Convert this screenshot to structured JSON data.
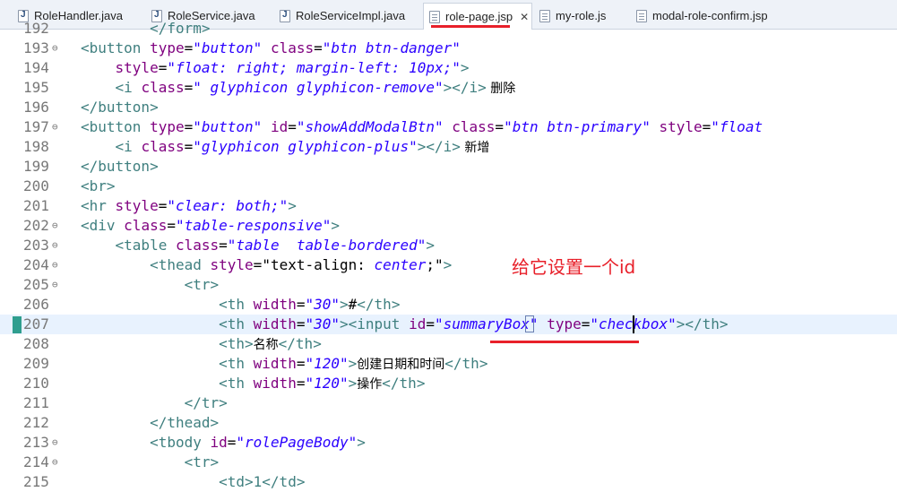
{
  "tabs": [
    {
      "label": "RoleHandler.java",
      "type": "java"
    },
    {
      "label": "RoleService.java",
      "type": "java"
    },
    {
      "label": "RoleServiceImpl.java",
      "type": "java"
    },
    {
      "label": "role-page.jsp",
      "type": "doc",
      "active": true
    },
    {
      "label": "my-role.js",
      "type": "doc"
    },
    {
      "label": "modal-role-confirm.jsp",
      "type": "doc"
    }
  ],
  "close_glyph": "✕",
  "annotation": "给它设置一个id",
  "colors": {
    "tag": "#3f7f7f",
    "attr": "#7f007f",
    "value": "#2a00ff",
    "annotation": "#e8202a"
  },
  "lines": [
    {
      "n": "192",
      "fold": false,
      "parts": [
        [
          "t",
          "        </form>"
        ]
      ]
    },
    {
      "n": "193",
      "fold": true,
      "parts": [
        [
          "t",
          "<button "
        ],
        [
          "a",
          "type"
        ],
        [
          "p",
          "="
        ],
        [
          "v",
          "\"button\""
        ],
        [
          "p",
          " "
        ],
        [
          "a",
          "class"
        ],
        [
          "p",
          "="
        ],
        [
          "v",
          "\"btn btn-danger\""
        ]
      ]
    },
    {
      "n": "194",
      "fold": false,
      "parts": [
        [
          "p",
          "    "
        ],
        [
          "a",
          "style"
        ],
        [
          "p",
          "="
        ],
        [
          "v",
          "\"float: right; margin-left: 10px;\""
        ],
        [
          "t",
          ">"
        ]
      ]
    },
    {
      "n": "195",
      "fold": false,
      "parts": [
        [
          "p",
          "    "
        ],
        [
          "t",
          "<i "
        ],
        [
          "a",
          "class"
        ],
        [
          "p",
          "="
        ],
        [
          "v",
          "\" glyphicon glyphicon-remove\""
        ],
        [
          "t",
          "></i>"
        ],
        [
          "cjk",
          " 删除"
        ]
      ]
    },
    {
      "n": "196",
      "fold": false,
      "parts": [
        [
          "t",
          "</button>"
        ]
      ]
    },
    {
      "n": "197",
      "fold": true,
      "parts": [
        [
          "t",
          "<button "
        ],
        [
          "a",
          "type"
        ],
        [
          "p",
          "="
        ],
        [
          "v",
          "\"button\""
        ],
        [
          "p",
          " "
        ],
        [
          "a",
          "id"
        ],
        [
          "p",
          "="
        ],
        [
          "v",
          "\"showAddModalBtn\""
        ],
        [
          "p",
          " "
        ],
        [
          "a",
          "class"
        ],
        [
          "p",
          "="
        ],
        [
          "v",
          "\"btn btn-primary\""
        ],
        [
          "p",
          " "
        ],
        [
          "a",
          "style"
        ],
        [
          "p",
          "="
        ],
        [
          "v",
          "\"float"
        ]
      ]
    },
    {
      "n": "198",
      "fold": false,
      "parts": [
        [
          "p",
          "    "
        ],
        [
          "t",
          "<i "
        ],
        [
          "a",
          "class"
        ],
        [
          "p",
          "="
        ],
        [
          "v",
          "\"glyphicon glyphicon-plus\""
        ],
        [
          "t",
          "></i>"
        ],
        [
          "cjk",
          " 新增"
        ]
      ]
    },
    {
      "n": "199",
      "fold": false,
      "parts": [
        [
          "t",
          "</button>"
        ]
      ]
    },
    {
      "n": "200",
      "fold": false,
      "parts": [
        [
          "t",
          "<br>"
        ]
      ]
    },
    {
      "n": "201",
      "fold": false,
      "parts": [
        [
          "t",
          "<hr "
        ],
        [
          "a",
          "style"
        ],
        [
          "p",
          "="
        ],
        [
          "v",
          "\"clear: both;\""
        ],
        [
          "t",
          ">"
        ]
      ]
    },
    {
      "n": "202",
      "fold": true,
      "parts": [
        [
          "t",
          "<div "
        ],
        [
          "a",
          "class"
        ],
        [
          "p",
          "="
        ],
        [
          "v",
          "\"table-responsive\""
        ],
        [
          "t",
          ">"
        ]
      ]
    },
    {
      "n": "203",
      "fold": true,
      "parts": [
        [
          "p",
          "    "
        ],
        [
          "t",
          "<table "
        ],
        [
          "a",
          "class"
        ],
        [
          "p",
          "="
        ],
        [
          "v",
          "\"table  table-bordered\""
        ],
        [
          "t",
          ">"
        ]
      ]
    },
    {
      "n": "204",
      "fold": true,
      "parts": [
        [
          "p",
          "        "
        ],
        [
          "t",
          "<thead "
        ],
        [
          "a",
          "style"
        ],
        [
          "p",
          "="
        ],
        [
          "p",
          "\"text-align: "
        ],
        [
          "v",
          "center"
        ],
        [
          "p",
          ";\""
        ],
        [
          "t",
          ">"
        ]
      ]
    },
    {
      "n": "205",
      "fold": true,
      "parts": [
        [
          "p",
          "            "
        ],
        [
          "t",
          "<tr>"
        ]
      ]
    },
    {
      "n": "206",
      "fold": false,
      "parts": [
        [
          "p",
          "                "
        ],
        [
          "t",
          "<th "
        ],
        [
          "a",
          "width"
        ],
        [
          "p",
          "="
        ],
        [
          "v",
          "\"30\""
        ],
        [
          "t",
          ">"
        ],
        [
          "p",
          "#"
        ],
        [
          "t",
          "</th>"
        ]
      ]
    },
    {
      "n": "207",
      "fold": false,
      "current": true,
      "parts": [
        [
          "p",
          "                "
        ],
        [
          "t",
          "<th "
        ],
        [
          "a",
          "width"
        ],
        [
          "p",
          "="
        ],
        [
          "v",
          "\"30\""
        ],
        [
          "t",
          "><input "
        ],
        [
          "a",
          "id"
        ],
        [
          "p",
          "="
        ],
        [
          "v",
          "\"summaryBox\""
        ],
        [
          "p",
          " "
        ],
        [
          "a",
          "type"
        ],
        [
          "p",
          "="
        ],
        [
          "v",
          "\"checkbox\""
        ],
        [
          "t",
          "></th>"
        ]
      ]
    },
    {
      "n": "208",
      "fold": false,
      "parts": [
        [
          "p",
          "                "
        ],
        [
          "t",
          "<th>"
        ],
        [
          "cjk",
          "名称"
        ],
        [
          "t",
          "</th>"
        ]
      ]
    },
    {
      "n": "209",
      "fold": false,
      "parts": [
        [
          "p",
          "                "
        ],
        [
          "t",
          "<th "
        ],
        [
          "a",
          "width"
        ],
        [
          "p",
          "="
        ],
        [
          "v",
          "\"120\""
        ],
        [
          "t",
          ">"
        ],
        [
          "cjk",
          "创建日期和时间"
        ],
        [
          "t",
          "</th>"
        ]
      ]
    },
    {
      "n": "210",
      "fold": false,
      "parts": [
        [
          "p",
          "                "
        ],
        [
          "t",
          "<th "
        ],
        [
          "a",
          "width"
        ],
        [
          "p",
          "="
        ],
        [
          "v",
          "\"120\""
        ],
        [
          "t",
          ">"
        ],
        [
          "cjk",
          "操作"
        ],
        [
          "t",
          "</th>"
        ]
      ]
    },
    {
      "n": "211",
      "fold": false,
      "parts": [
        [
          "p",
          "            "
        ],
        [
          "t",
          "</tr>"
        ]
      ]
    },
    {
      "n": "212",
      "fold": false,
      "parts": [
        [
          "p",
          "        "
        ],
        [
          "t",
          "</thead>"
        ]
      ]
    },
    {
      "n": "213",
      "fold": true,
      "parts": [
        [
          "p",
          "        "
        ],
        [
          "t",
          "<tbody "
        ],
        [
          "a",
          "id"
        ],
        [
          "p",
          "="
        ],
        [
          "v",
          "\"rolePageBody\""
        ],
        [
          "t",
          ">"
        ]
      ]
    },
    {
      "n": "214",
      "fold": true,
      "parts": [
        [
          "p",
          "            "
        ],
        [
          "t",
          "<tr>"
        ]
      ]
    },
    {
      "n": "215",
      "fold": false,
      "parts": [
        [
          "p",
          "                "
        ],
        [
          "t",
          "<td>1</td>"
        ]
      ]
    }
  ]
}
